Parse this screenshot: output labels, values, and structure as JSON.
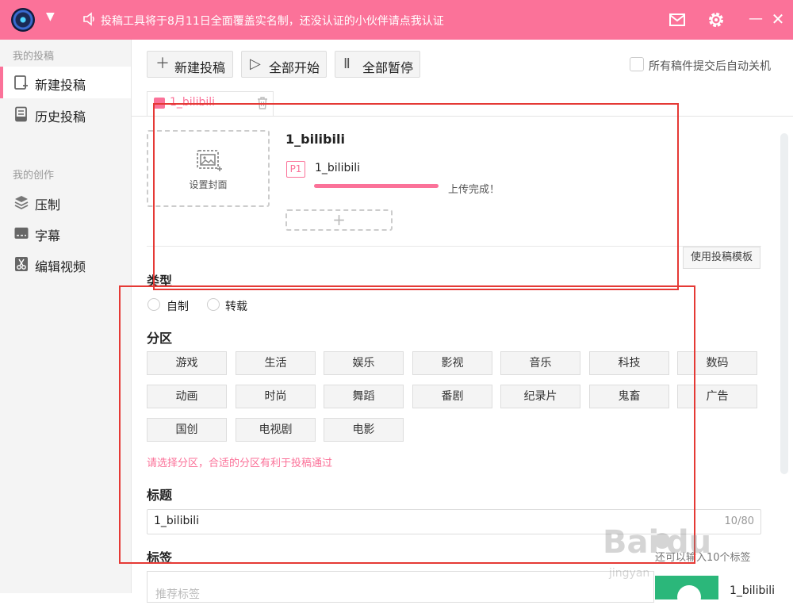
{
  "titlebar": {
    "notice": "投稿工具将于8月11日全面覆盖实名制，还没认证的小伙伴请点我认证",
    "minimize": "—",
    "close": "✕",
    "accent": "#fb7299"
  },
  "sidebar": {
    "section_posts": "我的投稿",
    "items_posts": [
      {
        "label": "新建投稿",
        "icon": "new-post-icon",
        "active": true
      },
      {
        "label": "历史投稿",
        "icon": "history-icon",
        "active": false
      }
    ],
    "section_create": "我的创作",
    "items_create": [
      {
        "label": "压制",
        "icon": "layers-icon"
      },
      {
        "label": "字幕",
        "icon": "subtitle-icon"
      },
      {
        "label": "编辑视频",
        "icon": "scissors-icon"
      }
    ]
  },
  "toolbar": {
    "new_post": "新建投稿",
    "start_all": "全部开始",
    "pause_all": "全部暂停",
    "auto_shutdown": "所有稿件提交后自动关机"
  },
  "file_tab": {
    "label": "1_bilibili"
  },
  "upload": {
    "cover_label": "设置封面",
    "video_title": "1_bilibili",
    "part_badge": "P1",
    "part_name": "1_bilibili",
    "progress": 1.0,
    "status": "上传完成！",
    "add_part": "+",
    "template_button": "使用投稿模板"
  },
  "type": {
    "title": "类型",
    "options": [
      "自制",
      "转载"
    ]
  },
  "zone": {
    "title": "分区",
    "items": [
      "游戏",
      "生活",
      "娱乐",
      "影视",
      "音乐",
      "科技",
      "数码",
      "动画",
      "时尚",
      "舞蹈",
      "番剧",
      "纪录片",
      "鬼畜",
      "广告",
      "国创",
      "电视剧",
      "电影"
    ],
    "hint": "请选择分区，合适的分区有利于投稿通过"
  },
  "title_field": {
    "label": "标题",
    "value": "1_bilibili",
    "count": "10/80"
  },
  "tags": {
    "label": "标签",
    "hint": "还可以输入10个标签",
    "placeholder": "推荐标签"
  },
  "preview": {
    "name": "1_bilibili"
  }
}
